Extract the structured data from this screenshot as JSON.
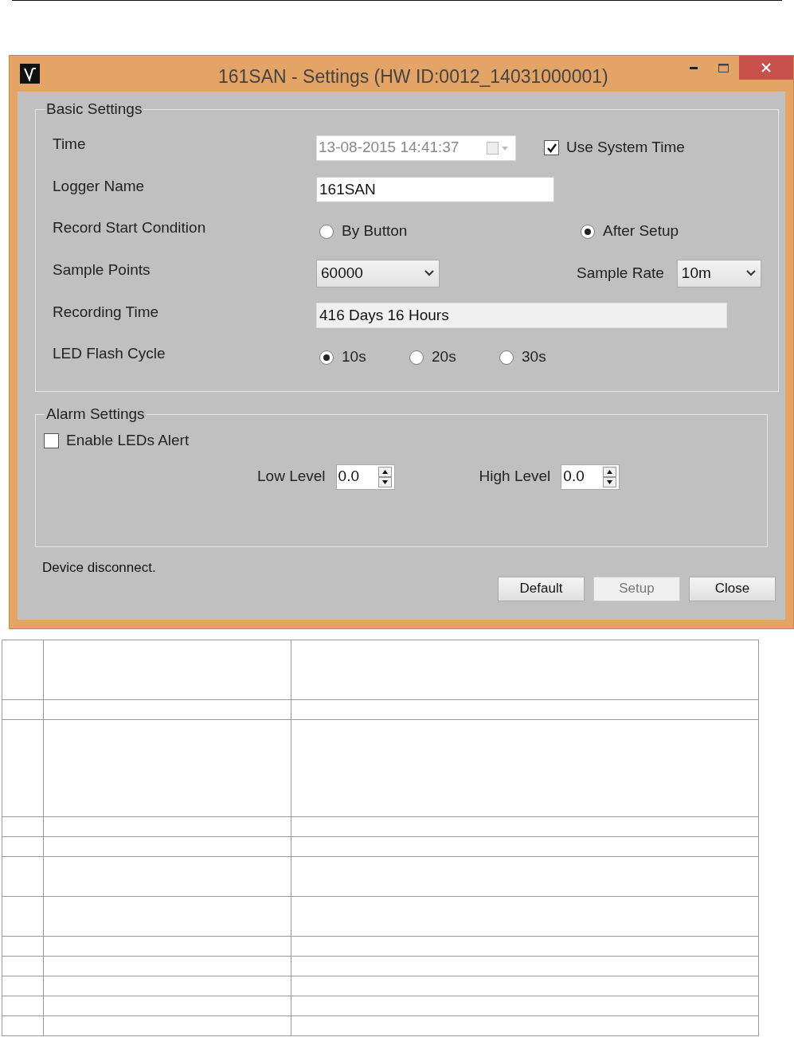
{
  "window": {
    "title": "161SAN - Settings (HW ID:0012_14031000001)"
  },
  "basic_settings": {
    "legend": "Basic Settings",
    "time": {
      "label": "Time",
      "value": "13-08-2015 14:41:37",
      "disabled": true,
      "use_system_time": {
        "label": "Use System Time",
        "checked": true
      }
    },
    "logger_name": {
      "label": "Logger Name",
      "value": "161SAN"
    },
    "record_start_condition": {
      "label": "Record Start Condition",
      "options": [
        {
          "label": "By Button",
          "selected": false
        },
        {
          "label": "After Setup",
          "selected": true
        }
      ]
    },
    "sample_points": {
      "label": "Sample Points",
      "value": "60000"
    },
    "sample_rate": {
      "label": "Sample Rate",
      "value": "10m"
    },
    "recording_time": {
      "label": "Recording Time",
      "value": "416 Days 16 Hours"
    },
    "led_flash_cycle": {
      "label": "LED Flash Cycle",
      "options": [
        {
          "label": "10s",
          "selected": true
        },
        {
          "label": "20s",
          "selected": false
        },
        {
          "label": "30s",
          "selected": false
        }
      ]
    }
  },
  "alarm_settings": {
    "legend": "Alarm Settings",
    "enable_leds_alert": {
      "label": "Enable LEDs Alert",
      "checked": false
    },
    "low_level": {
      "label": "Low Level",
      "value": "0.0"
    },
    "high_level": {
      "label": "High Level",
      "value": "0.0"
    }
  },
  "status": "Device disconnect.",
  "buttons": [
    {
      "label": "Default",
      "disabled": false
    },
    {
      "label": "Setup",
      "disabled": true
    },
    {
      "label": "Close",
      "disabled": false
    }
  ]
}
